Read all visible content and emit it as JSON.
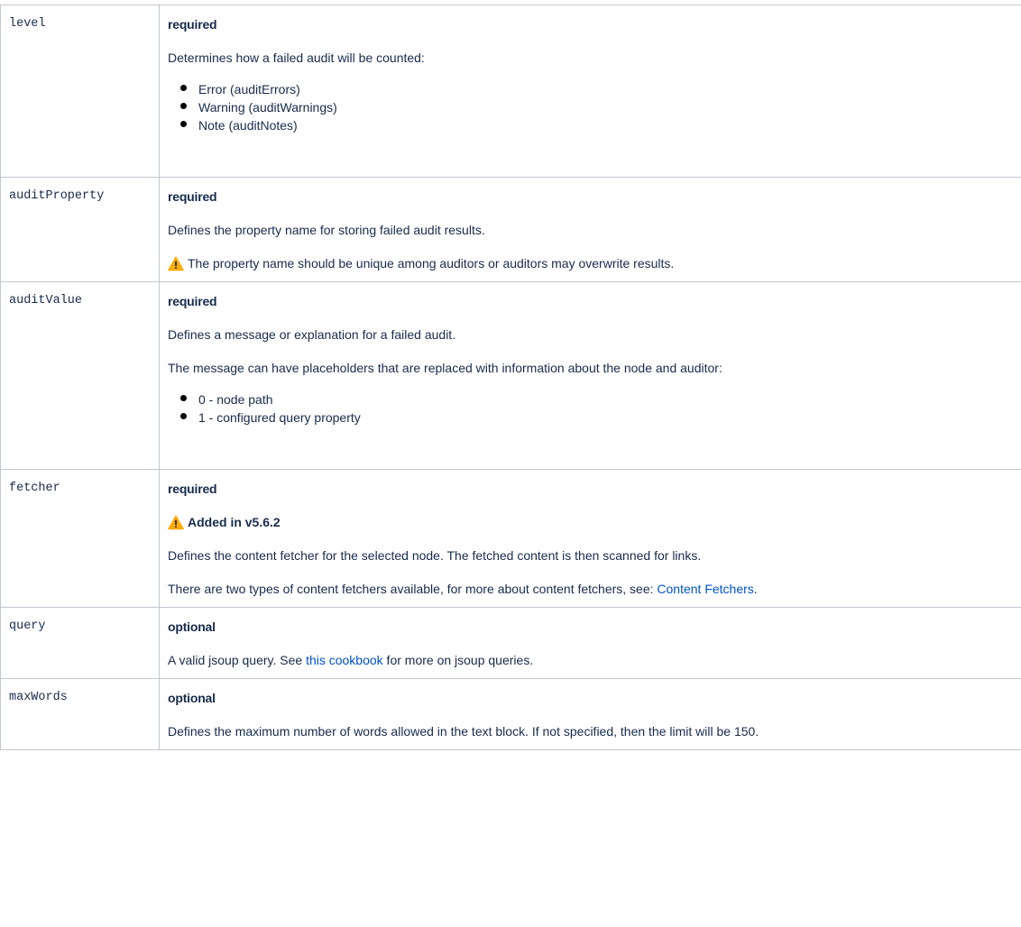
{
  "rows": [
    {
      "key": "level",
      "requirement": "required",
      "description": "Determines how a failed audit will be counted:",
      "items": [
        "Error (auditErrors)",
        "Warning (auditWarnings)",
        "Note (auditNotes)"
      ]
    },
    {
      "key": "auditProperty",
      "requirement": "required",
      "description": "Defines the property name for storing failed audit results.",
      "warning": "The property name should be unique among auditors or auditors may overwrite results."
    },
    {
      "key": "auditValue",
      "requirement": "required",
      "description": "Defines a message or explanation for a failed audit.",
      "description2": "The message can have placeholders that are replaced with information about the node and auditor:",
      "items": [
        "0 - node path",
        "1 - configured query property"
      ]
    },
    {
      "key": "fetcher",
      "requirement": "required",
      "warning": "Added in v5.6.2",
      "description": "Defines the content fetcher for the selected node. The fetched content is then scanned for links.",
      "description2_prefix": "There are two types of content fetchers available, for more about content fetchers, see: ",
      "link": "Content Fetchers",
      "description2_suffix": "."
    },
    {
      "key": "query",
      "requirement": "optional",
      "description_prefix": "A valid jsoup query. See ",
      "link": "this cookbook",
      "description_suffix": " for more on jsoup queries."
    },
    {
      "key": "maxWords",
      "requirement": "optional",
      "description": "Defines the maximum number of words allowed in the text block. If not specified, then the limit will be 150."
    }
  ],
  "colors": {
    "border": "#c1c7d0",
    "link": "#0052cc",
    "warning_icon": "#ffab00"
  },
  "icons": {
    "warning": "warning-icon"
  }
}
